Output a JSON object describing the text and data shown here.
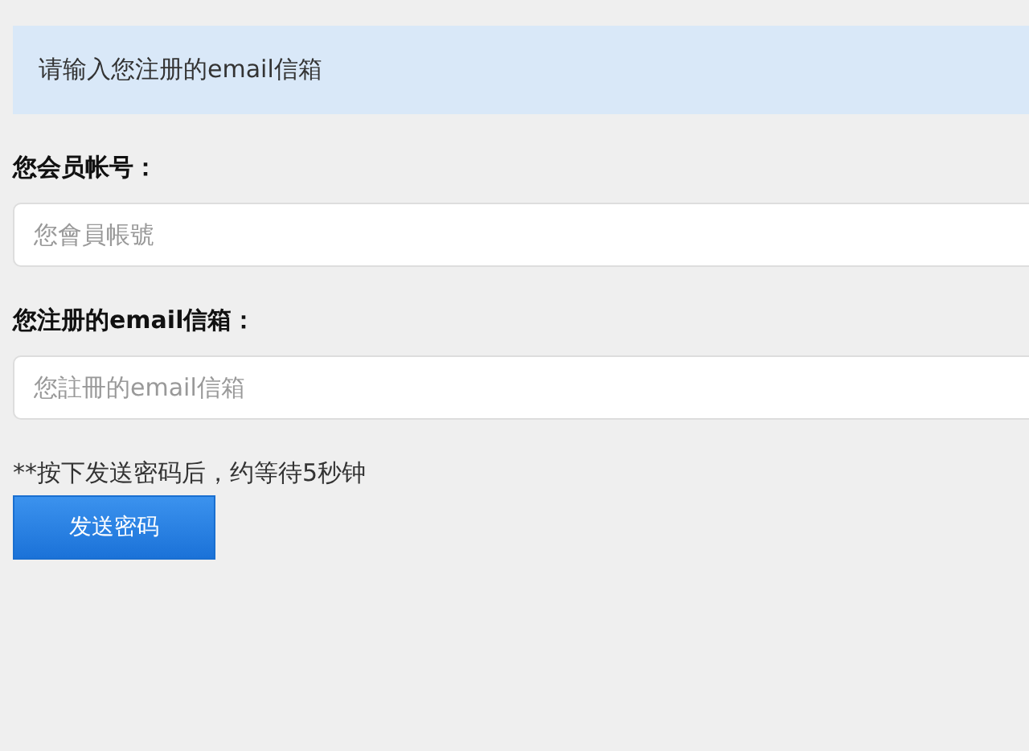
{
  "alert": {
    "text": "请输入您注册的email信箱"
  },
  "fields": [
    {
      "label": "您会员帐号：",
      "placeholder": "您會員帳號"
    },
    {
      "label": "您注册的email信箱：",
      "placeholder": "您註冊的email信箱"
    }
  ],
  "note": "**按下发送密码后，约等待5秒钟",
  "button": {
    "label": "发送密码"
  }
}
